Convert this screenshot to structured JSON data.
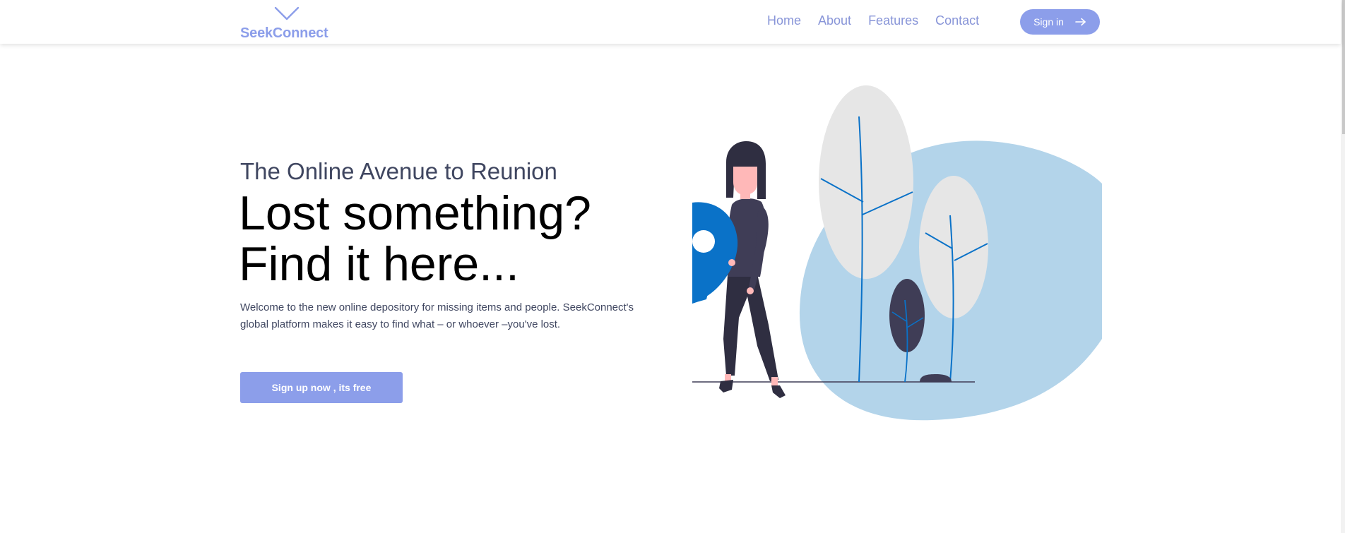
{
  "header": {
    "brand": "SeekConnect",
    "nav": [
      {
        "label": "Home"
      },
      {
        "label": "About"
      },
      {
        "label": "Features"
      },
      {
        "label": "Contact"
      }
    ],
    "signin_label": "Sign in"
  },
  "hero": {
    "subtitle": "The Online Avenue to Reunion",
    "headline_line1": "Lost something?",
    "headline_line2": "Find it here...",
    "description": "Welcome to the new online depository for missing items and people. SeekConnect's global platform makes it easy to find what – or whoever –you've lost.",
    "cta_label": "Sign up now , its free"
  },
  "colors": {
    "accent": "#8c9eea",
    "nav_text": "#8895d8",
    "blob": "#b3d4ea",
    "pin": "#0a72c8",
    "figure_dark": "#3f3d56",
    "leaf": "#e6e6e6"
  },
  "icons": {
    "logo": "chevron-down-icon",
    "signin": "arrow-right-icon"
  }
}
